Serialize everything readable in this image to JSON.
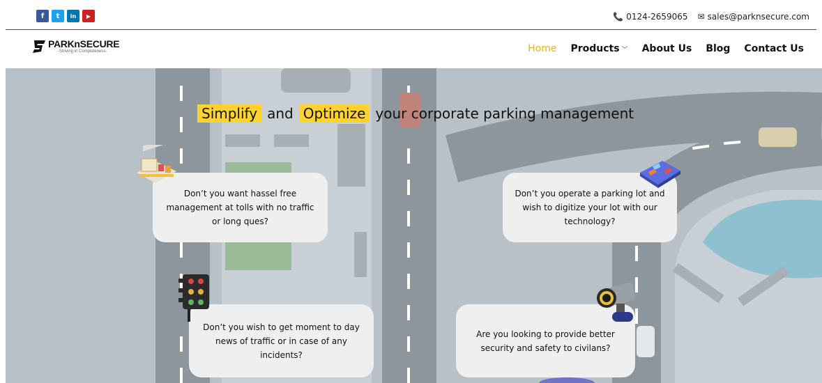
{
  "topbar": {
    "social": [
      {
        "name": "facebook-icon",
        "glyph": "f",
        "color": "#3b5998"
      },
      {
        "name": "twitter-icon",
        "glyph": "t",
        "color": "#1da1f2"
      },
      {
        "name": "linkedin-icon",
        "glyph": "in",
        "color": "#0077b5"
      },
      {
        "name": "youtube-icon",
        "glyph": "▶",
        "color": "#cd201f"
      }
    ],
    "phone": "0124-2659065",
    "email": "sales@parknsecure.com"
  },
  "nav": {
    "logo_name": "PARKnSECURE",
    "logo_tag": "-Striving in Completeness-",
    "items": [
      {
        "label": "Home",
        "active": true
      },
      {
        "label": "Products",
        "dropdown": true
      },
      {
        "label": "About Us"
      },
      {
        "label": "Blog"
      },
      {
        "label": "Contact Us"
      }
    ]
  },
  "hero": {
    "word1": "Simplify",
    "and": "and",
    "word2": "Optimize",
    "rest": "your corporate parking management",
    "cards": [
      {
        "lines": [
          "Don’t you want hassel free",
          "management at tolls with no traffic",
          "or long ques?"
        ]
      },
      {
        "lines": [
          "Don’t you operate a parking lot and",
          "wish to digitize your lot with our",
          "technology?"
        ]
      },
      {
        "lines": [
          "Don’t you wish to get moment to day",
          "news of traffic or in case of any",
          "incidents?"
        ]
      },
      {
        "lines": [
          "Are you looking to provide better",
          "security and safety to civilans?"
        ]
      }
    ]
  },
  "colors": {
    "accent": "#f4b400",
    "highlight": "#ffd22e",
    "hero_bg": "#b9c2c9"
  }
}
